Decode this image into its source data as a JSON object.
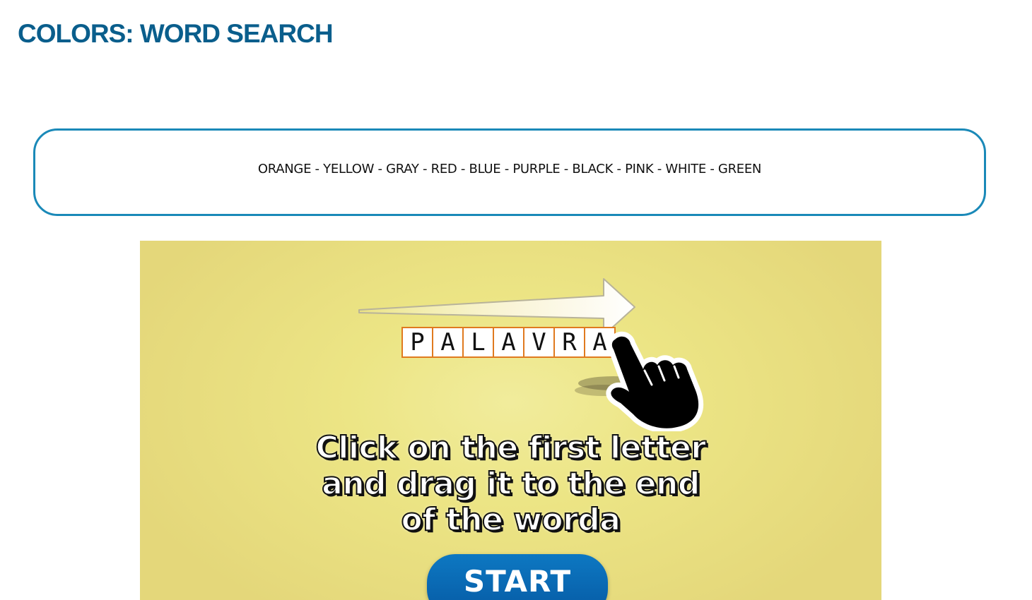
{
  "page": {
    "title": "COLORS: WORD SEARCH"
  },
  "word_list": {
    "text": "ORANGE - YELLOW - GRAY - RED - BLUE - PURPLE - BLACK - PINK - WHITE - GREEN"
  },
  "game": {
    "demo_letters": [
      "P",
      "A",
      "L",
      "A",
      "V",
      "R",
      "A"
    ],
    "instructions": {
      "line1": "Click on the first letter",
      "line2": "and drag it to the end",
      "line3": "of the worda"
    },
    "start_label": "START",
    "colors": {
      "background": "#ece585",
      "cell_border": "#e07a1f",
      "start_button": "#0a6bb6",
      "title": "#0a5e8c",
      "word_box_border": "#1a89b8"
    },
    "icons": [
      "arrow-right-icon",
      "pointer-hand-icon"
    ]
  }
}
